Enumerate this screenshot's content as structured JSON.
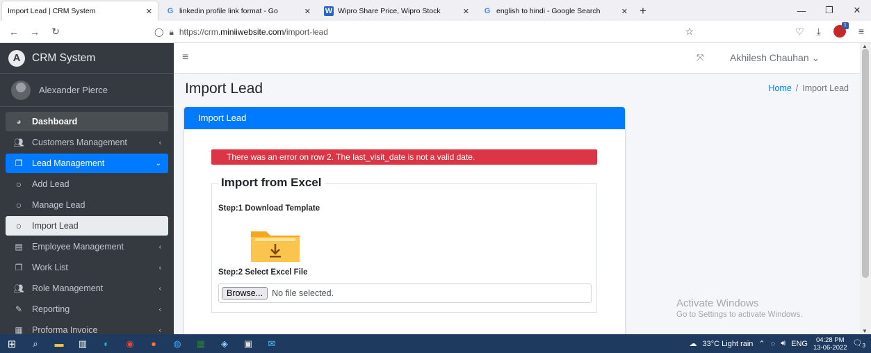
{
  "browser": {
    "tabs": [
      {
        "title": "Import Lead | CRM System",
        "active": true,
        "favicon": "none"
      },
      {
        "title": "linkedin profile link format - Go",
        "active": false,
        "favicon": "google-icon"
      },
      {
        "title": "Wipro Share Price, Wipro Stock",
        "active": false,
        "favicon": "wipro-icon"
      },
      {
        "title": "english to hindi - Google Search",
        "active": false,
        "favicon": "google-icon"
      }
    ],
    "url_prefix": "https://crm.",
    "url_host": "miniiwebsite.com",
    "url_path": "/import-lead"
  },
  "app": {
    "brand": "CRM System",
    "user_name": "Alexander Pierce",
    "top_user": "Akhilesh Chauhan"
  },
  "sidebar": {
    "items": [
      {
        "label": "Dashboard",
        "icon": "dashboard-icon"
      },
      {
        "label": "Customers Management",
        "icon": "users-icon"
      },
      {
        "label": "Lead Management",
        "icon": "copy-icon"
      },
      {
        "label": "Add Lead",
        "icon": "circle-icon"
      },
      {
        "label": "Manage Lead",
        "icon": "circle-icon"
      },
      {
        "label": "Import Lead",
        "icon": "circle-icon"
      },
      {
        "label": "Employee Management",
        "icon": "id-card-icon"
      },
      {
        "label": "Work List",
        "icon": "copy-icon"
      },
      {
        "label": "Role Management",
        "icon": "users-icon"
      },
      {
        "label": "Reporting",
        "icon": "edit-icon"
      },
      {
        "label": "Proforma Invoice",
        "icon": "invoice-icon"
      }
    ]
  },
  "page": {
    "title": "Import Lead",
    "breadcrumb_home": "Home",
    "breadcrumb_sep": "/",
    "breadcrumb_current": "Import Lead",
    "card_title": "Import Lead",
    "error": "There was an error on row 2. The last_visit_date is not a valid date.",
    "legend": "Import from Excel",
    "step1": "Step:1 Download Template",
    "step2": "Step:2 Select Excel File",
    "browse_label": "Browse...",
    "file_status": "No file selected."
  },
  "watermark": {
    "title": "Activate Windows",
    "subtitle": "Go to Settings to activate Windows."
  },
  "taskbar": {
    "weather": "33°C  Light rain",
    "lang": "ENG",
    "time": "04:28 PM",
    "date": "13-06-2022",
    "notification_count": "3"
  },
  "colors": {
    "primary": "#007bff",
    "danger": "#dc3545",
    "sidebar_bg": "#343a40"
  }
}
